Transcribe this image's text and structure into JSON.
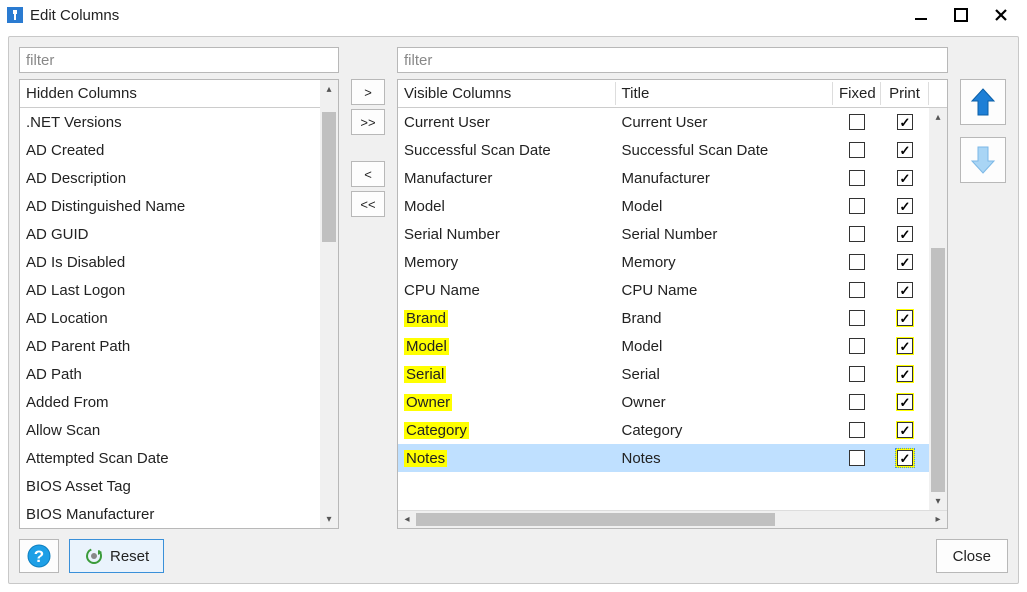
{
  "window": {
    "title": "Edit Columns"
  },
  "left": {
    "filter_placeholder": "filter",
    "header": "Hidden Columns",
    "items": [
      ".NET Versions",
      "AD Created",
      "AD Description",
      "AD Distinguished Name",
      "AD GUID",
      "AD Is Disabled",
      "AD Last Logon",
      "AD Location",
      "AD Parent Path",
      "AD Path",
      "Added From",
      "Allow Scan",
      "Attempted Scan Date",
      "BIOS Asset Tag",
      "BIOS Manufacturer"
    ]
  },
  "mid": {
    "add_one": ">",
    "add_all": ">>",
    "remove_one": "<",
    "remove_all": "<<"
  },
  "right": {
    "filter_placeholder": "filter",
    "headers": {
      "name": "Visible Columns",
      "title": "Title",
      "fixed": "Fixed",
      "print": "Print"
    },
    "rows": [
      {
        "name": "Current User",
        "title": "Current User",
        "fixed": false,
        "print": true,
        "hl": false,
        "hl_print": false,
        "selected": false
      },
      {
        "name": "Successful Scan Date",
        "title": "Successful Scan Date",
        "fixed": false,
        "print": true,
        "hl": false,
        "hl_print": false,
        "selected": false
      },
      {
        "name": "Manufacturer",
        "title": "Manufacturer",
        "fixed": false,
        "print": true,
        "hl": false,
        "hl_print": false,
        "selected": false
      },
      {
        "name": "Model",
        "title": "Model",
        "fixed": false,
        "print": true,
        "hl": false,
        "hl_print": false,
        "selected": false
      },
      {
        "name": "Serial Number",
        "title": "Serial Number",
        "fixed": false,
        "print": true,
        "hl": false,
        "hl_print": false,
        "selected": false
      },
      {
        "name": "Memory",
        "title": "Memory",
        "fixed": false,
        "print": true,
        "hl": false,
        "hl_print": false,
        "selected": false
      },
      {
        "name": "CPU Name",
        "title": "CPU Name",
        "fixed": false,
        "print": true,
        "hl": false,
        "hl_print": false,
        "selected": false
      },
      {
        "name": "Brand",
        "title": "Brand",
        "fixed": false,
        "print": true,
        "hl": true,
        "hl_print": true,
        "selected": false
      },
      {
        "name": "Model",
        "title": "Model",
        "fixed": false,
        "print": true,
        "hl": true,
        "hl_print": true,
        "selected": false
      },
      {
        "name": "Serial",
        "title": "Serial",
        "fixed": false,
        "print": true,
        "hl": true,
        "hl_print": true,
        "selected": false
      },
      {
        "name": "Owner",
        "title": "Owner",
        "fixed": false,
        "print": true,
        "hl": true,
        "hl_print": true,
        "selected": false
      },
      {
        "name": "Category",
        "title": "Category",
        "fixed": false,
        "print": true,
        "hl": true,
        "hl_print": true,
        "selected": false
      },
      {
        "name": "Notes",
        "title": "Notes",
        "fixed": false,
        "print": true,
        "hl": true,
        "hl_print": true,
        "selected": true
      }
    ]
  },
  "footer": {
    "reset_label": "Reset",
    "close_label": "Close"
  }
}
